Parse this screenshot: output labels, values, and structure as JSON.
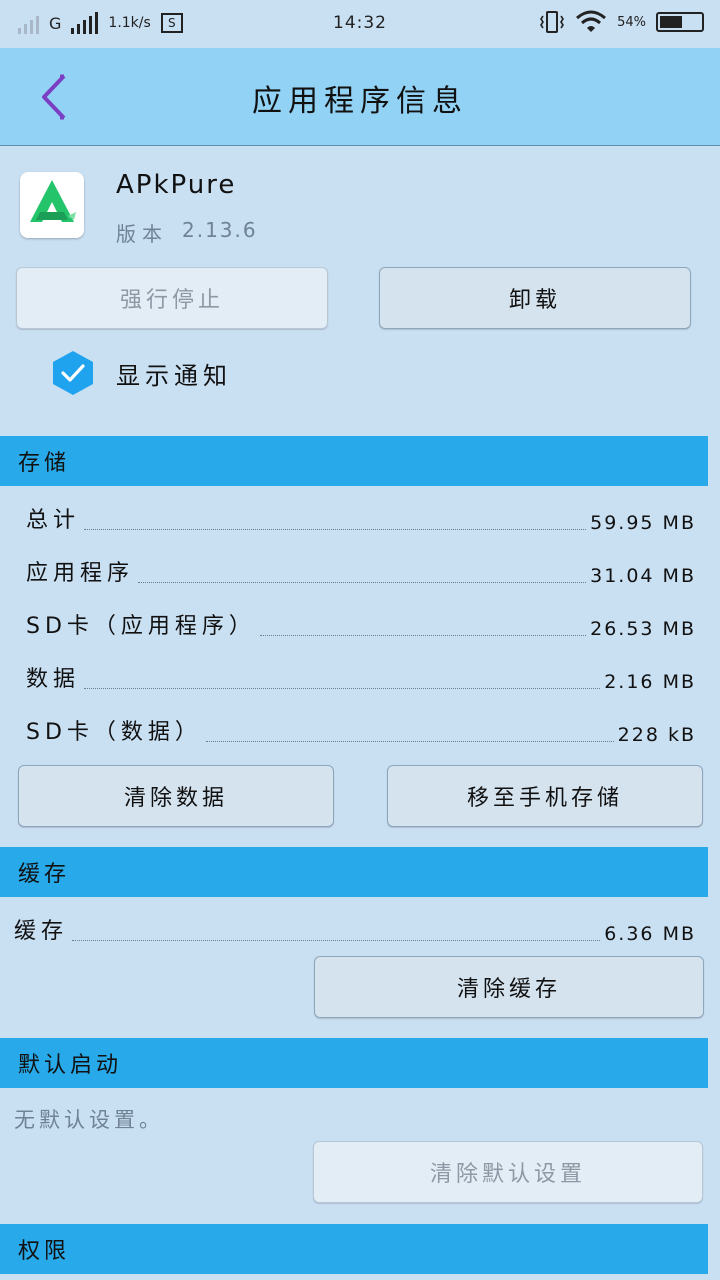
{
  "status_bar": {
    "carrier": "G",
    "speed": "1.1k/s",
    "sim_label": "S",
    "time": "14:32",
    "battery": "54%",
    "battery_level": 0.54
  },
  "header": {
    "title": "应用程序信息"
  },
  "app": {
    "name": "APkPure",
    "version_label": "版本",
    "version": "2.13.6",
    "icon": "apkpure-logo"
  },
  "actions": {
    "force_stop": "强行停止",
    "uninstall": "卸载"
  },
  "notification": {
    "label": "显示通知",
    "checked": true
  },
  "storage": {
    "header": "存储",
    "rows": [
      {
        "label": "总计",
        "value": "59.95 MB"
      },
      {
        "label": "应用程序",
        "value": "31.04 MB"
      },
      {
        "label": "SD卡（应用程序）",
        "value": "26.53 MB"
      },
      {
        "label": "数据",
        "value": "2.16 MB"
      },
      {
        "label": "SD卡（数据）",
        "value": "228 kB"
      }
    ],
    "clear_data": "清除数据",
    "move_storage": "移至手机存储"
  },
  "cache": {
    "header": "缓存",
    "label": "缓存",
    "value": "6.36 MB",
    "clear_cache": "清除缓存"
  },
  "default_launch": {
    "header": "默认启动",
    "text": "无默认设置。",
    "clear_defaults": "清除默认设置"
  },
  "permissions": {
    "header": "权限"
  },
  "colors": {
    "background": "#c9dff2",
    "title_bar": "#92d3f5",
    "section_header": "#27a9ea",
    "check_accent": "#1fa3ef",
    "back_arrow": "#7b3fc4"
  }
}
